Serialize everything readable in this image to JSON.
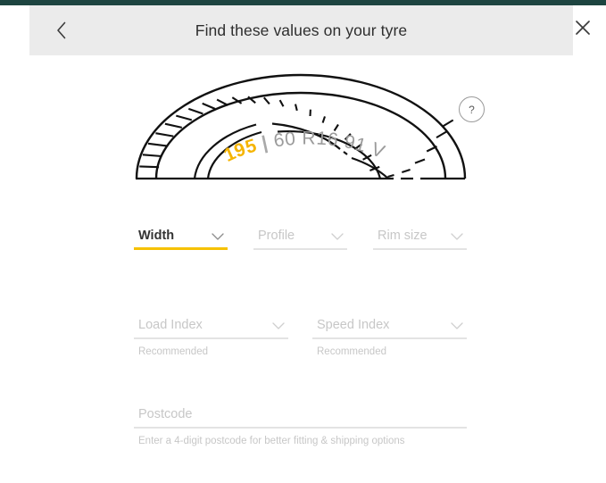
{
  "window": {
    "top_strip_color": "#1d4440",
    "header_bg": "#ebebeb",
    "accent_color": "#f6c101"
  },
  "header": {
    "title": "Find these values on your tyre",
    "back_icon": "chevron-left-icon",
    "close_icon": "close-icon"
  },
  "illustration": {
    "name": "tyre-sidewall-diagram",
    "markings": {
      "width": "195",
      "separator": "|",
      "profile": "60",
      "rim": "R16",
      "load_index": "91",
      "speed_index": "V"
    },
    "highlight_color": "#f5b400",
    "marking_color": "#9b9b9b",
    "help_button_label": "?"
  },
  "form": {
    "fields": [
      {
        "id": "width",
        "label": "Width",
        "state": "active",
        "helper": ""
      },
      {
        "id": "profile",
        "label": "Profile",
        "state": "placeholder",
        "helper": ""
      },
      {
        "id": "rim",
        "label": "Rim size",
        "state": "placeholder",
        "helper": ""
      },
      {
        "id": "load",
        "label": "Load Index",
        "state": "placeholder",
        "helper": "Recommended"
      },
      {
        "id": "speed",
        "label": "Speed Index",
        "state": "placeholder",
        "helper": "Recommended"
      },
      {
        "id": "postcode",
        "label": "Postcode",
        "state": "placeholder",
        "helper": "Enter a 4-digit postcode for better fitting & shipping options"
      }
    ]
  }
}
